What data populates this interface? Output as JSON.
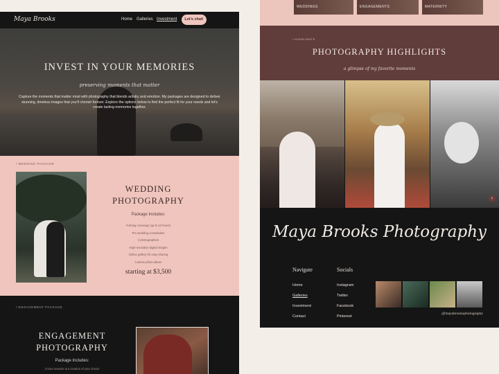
{
  "left_page": {
    "nav": {
      "logo": "Maya Brooks",
      "links": [
        "Home",
        "Galleries",
        "Investment"
      ],
      "cta": "Let's chat!"
    },
    "hero": {
      "title": "INVEST IN YOUR MEMORIES",
      "subtitle": "preserving moments that matter",
      "body": "Capture the moments that matter most with photography that blends artistry and emotion. My packages are designed to deliver stunning, timeless images that you'll cherish forever. Explore the options below to find the perfect fit for your needs and let's create lasting memories together."
    },
    "wedding": {
      "label": "/ WEDDING PACKAGE",
      "title_line1": "WEDDING",
      "title_line2": "PHOTOGRAPHY",
      "includes": "Package Includes:",
      "items": [
        "Full-day coverage (up to 10 hours)",
        "Pre-wedding consultation",
        "2 photographers",
        "High-resolution digital images",
        "Online gallery for easy sharing",
        "Custom photo album"
      ],
      "price": "starting at $3,500"
    },
    "engagement": {
      "label": "/ ENGAGEMENT PACKAGE",
      "title_line1": "ENGAGEMENT",
      "title_line2": "PHOTOGRAPHY",
      "includes": "Package Includes:",
      "first_item": "2-hour session at a location of your choice"
    }
  },
  "right_page": {
    "top_tiles": [
      "WEDDINGS",
      "ENGAGEMENTS",
      "MATERNITY"
    ],
    "highlights": {
      "label": "/ HIGHLIGHTS",
      "title": "PHOTOGRAPHY HIGHLIGHTS",
      "subtitle": "a glimpse of my favorite moments"
    },
    "gallery_next": "‹",
    "footer": {
      "brand": "Maya Brooks Photography",
      "navigate_heading": "Navigate",
      "navigate_links": [
        "Home",
        "Galleries",
        "Investment",
        "Contact"
      ],
      "socials_heading": "Socials",
      "socials_links": [
        "Instagram",
        "Twitter",
        "Facebook",
        "Pinterest"
      ],
      "handle": "@mayabrooksphotography"
    }
  }
}
